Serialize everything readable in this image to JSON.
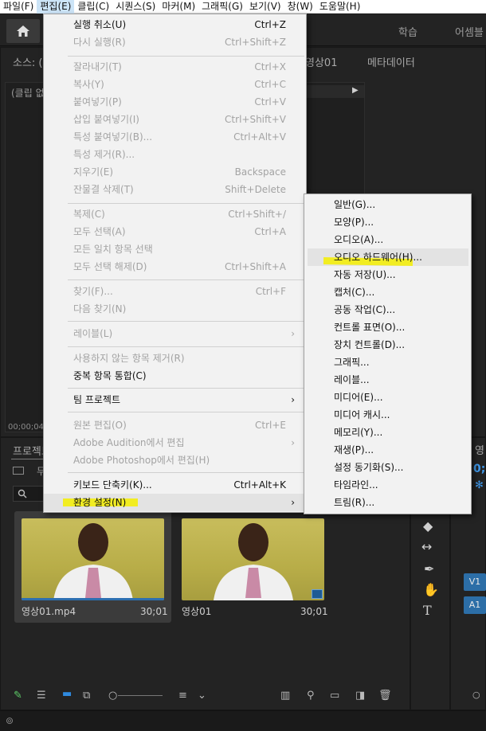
{
  "menubar": {
    "items": [
      {
        "label": "파일(F)"
      },
      {
        "label": "편집(E)"
      },
      {
        "label": "클립(C)"
      },
      {
        "label": "시퀀스(S)"
      },
      {
        "label": "마커(M)"
      },
      {
        "label": "그래픽(G)"
      },
      {
        "label": "보기(V)"
      },
      {
        "label": "창(W)"
      },
      {
        "label": "도움말(H)"
      }
    ]
  },
  "header": {
    "workspace_tabs": [
      "학습",
      "어셈블"
    ]
  },
  "source_panel": {
    "tab_source": "소스: (",
    "tab_seq": "영상01",
    "tab_meta": "메타데이터",
    "clip_label": "(클립 없음)",
    "timecode": "00;00;04;"
  },
  "edit_menu": {
    "items": [
      {
        "label": "실행 취소(U)",
        "shortcut": "Ctrl+Z",
        "enabled": true
      },
      {
        "label": "다시 실행(R)",
        "shortcut": "Ctrl+Shift+Z",
        "enabled": false
      },
      {
        "label": "잘라내기(T)",
        "shortcut": "Ctrl+X",
        "enabled": false
      },
      {
        "label": "복사(Y)",
        "shortcut": "Ctrl+C",
        "enabled": false
      },
      {
        "label": "붙여넣기(P)",
        "shortcut": "Ctrl+V",
        "enabled": false
      },
      {
        "label": "삽입 붙여넣기(I)",
        "shortcut": "Ctrl+Shift+V",
        "enabled": false
      },
      {
        "label": "특성 붙여넣기(B)...",
        "shortcut": "Ctrl+Alt+V",
        "enabled": false
      },
      {
        "label": "특성 제거(R)...",
        "shortcut": "",
        "enabled": false
      },
      {
        "label": "지우기(E)",
        "shortcut": "Backspace",
        "enabled": false
      },
      {
        "label": "잔물결 삭제(T)",
        "shortcut": "Shift+Delete",
        "enabled": false
      },
      {
        "label": "복제(C)",
        "shortcut": "Ctrl+Shift+/",
        "enabled": false
      },
      {
        "label": "모두 선택(A)",
        "shortcut": "Ctrl+A",
        "enabled": false
      },
      {
        "label": "모든 일치 항목 선택",
        "shortcut": "",
        "enabled": false
      },
      {
        "label": "모두 선택 해제(D)",
        "shortcut": "Ctrl+Shift+A",
        "enabled": false
      },
      {
        "label": "찾기(F)...",
        "shortcut": "Ctrl+F",
        "enabled": false
      },
      {
        "label": "다음 찾기(N)",
        "shortcut": "",
        "enabled": false
      },
      {
        "label": "레이블(L)",
        "shortcut": "",
        "enabled": false,
        "submenu": true
      },
      {
        "label": "사용하지 않는 항목 제거(R)",
        "shortcut": "",
        "enabled": false
      },
      {
        "label": "중복 항목 통합(C)",
        "shortcut": "",
        "enabled": true
      },
      {
        "label": "팀 프로젝트",
        "shortcut": "",
        "enabled": true,
        "submenu": true
      },
      {
        "label": "원본 편집(O)",
        "shortcut": "Ctrl+E",
        "enabled": false
      },
      {
        "label": "Adobe Audition에서 편집",
        "shortcut": "",
        "enabled": false,
        "submenu": true
      },
      {
        "label": "Adobe Photoshop에서 편집(H)",
        "shortcut": "",
        "enabled": false
      },
      {
        "label": "키보드 단축키(K)...",
        "shortcut": "Ctrl+Alt+K",
        "enabled": true
      },
      {
        "label": "환경 설정(N)",
        "shortcut": "",
        "enabled": true,
        "submenu": true
      }
    ],
    "arrow": "›"
  },
  "prefs_submenu": {
    "items": [
      {
        "label": "일반(G)..."
      },
      {
        "label": "모양(P)..."
      },
      {
        "label": "오디오(A)..."
      },
      {
        "label": "오디오 하드웨어(H)..."
      },
      {
        "label": "자동 저장(U)..."
      },
      {
        "label": "캡처(C)..."
      },
      {
        "label": "공동 작업(C)..."
      },
      {
        "label": "컨트롤 표면(O)..."
      },
      {
        "label": "장치 컨트롤(D)..."
      },
      {
        "label": "그래픽..."
      },
      {
        "label": "레이블..."
      },
      {
        "label": "미디어(E)..."
      },
      {
        "label": "미디어 캐시..."
      },
      {
        "label": "메모리(Y)..."
      },
      {
        "label": "재생(P)..."
      },
      {
        "label": "설정 동기화(S)..."
      },
      {
        "label": "타임라인..."
      },
      {
        "label": "트림(R)..."
      }
    ]
  },
  "project_panel": {
    "tab": "프로젝트",
    "row2": "무",
    "clips": [
      {
        "name": "영상01.mp4",
        "duration": "30;01"
      },
      {
        "name": "영상01",
        "duration": "30;01"
      }
    ]
  },
  "timeline": {
    "tab": "영",
    "timecode": "0;",
    "tracks": [
      "V1",
      "A1"
    ]
  },
  "colors": {
    "highlight": "#f5ef00",
    "accent": "#2c6ea7"
  }
}
